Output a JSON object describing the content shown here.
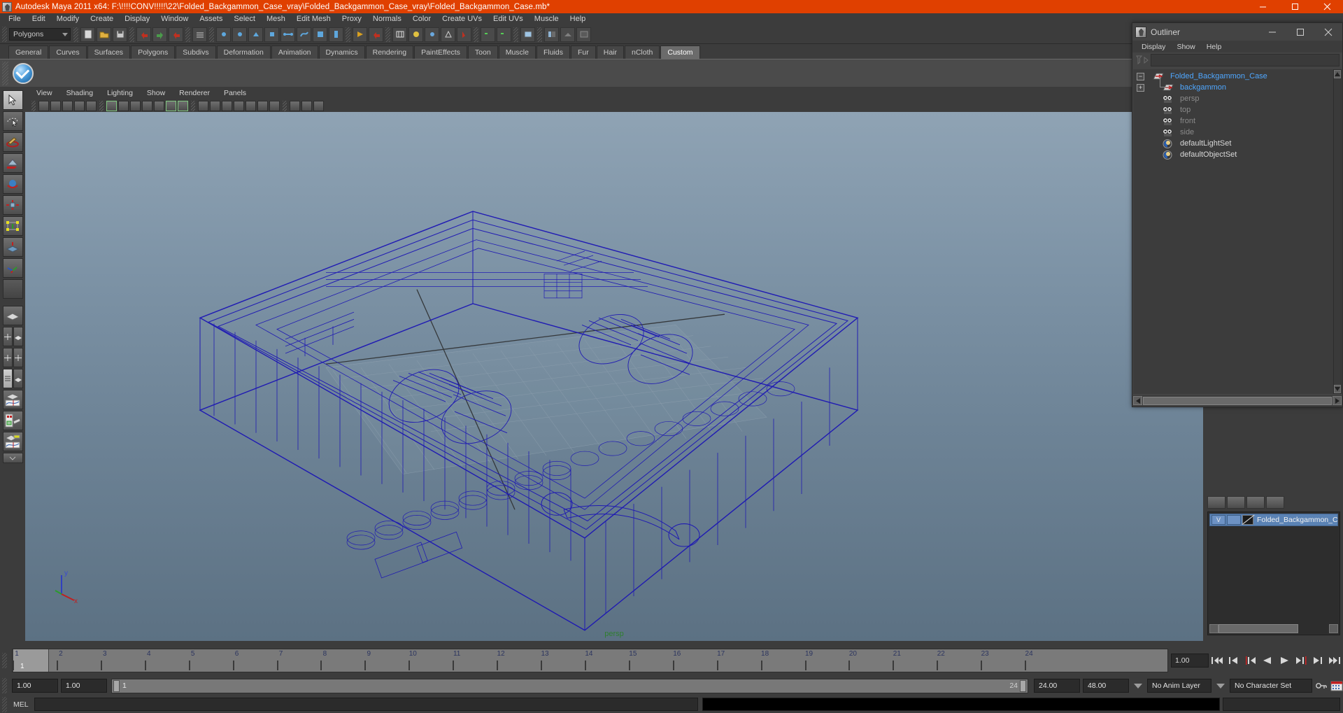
{
  "titlebar": {
    "app_title": "Autodesk Maya 2011 x64: F:\\!!!!CONV!!!!!\\22\\Folded_Backgammon_Case_vray\\Folded_Backgammon_Case_vray\\Folded_Backgammon_Case.mb*",
    "accent_color": "#e04000",
    "minimize": "minimize-icon",
    "maximize": "maximize-icon",
    "close": "close-icon"
  },
  "menubar": {
    "items": [
      "File",
      "Edit",
      "Modify",
      "Create",
      "Display",
      "Window",
      "Assets",
      "Select",
      "Mesh",
      "Edit Mesh",
      "Proxy",
      "Normals",
      "Color",
      "Create UVs",
      "Edit UVs",
      "Muscle",
      "Help"
    ]
  },
  "statusline": {
    "mode_selector": "Polygons"
  },
  "shelf": {
    "tabs": [
      "General",
      "Curves",
      "Surfaces",
      "Polygons",
      "Subdivs",
      "Deformation",
      "Animation",
      "Dynamics",
      "Rendering",
      "PaintEffects",
      "Toon",
      "Muscle",
      "Fluids",
      "Fur",
      "Hair",
      "nCloth",
      "Custom"
    ],
    "active_tab": "Custom"
  },
  "viewport": {
    "menus": [
      "View",
      "Shading",
      "Lighting",
      "Show",
      "Renderer",
      "Panels"
    ],
    "camera_label": "persp",
    "camera_label_color": "#2f7f2f",
    "wireframe_color": "#1c16b4",
    "axis_y_label": "y",
    "axis_x_label": "x",
    "axis_z_label": "z"
  },
  "outliner": {
    "window_title": "Outliner",
    "menus": [
      "Display",
      "Show",
      "Help"
    ],
    "search_value": "",
    "items": [
      {
        "label": "Folded_Backgammon_Case",
        "icon": "transform-icon",
        "expander": "minus",
        "indent": 0,
        "style": "blue"
      },
      {
        "label": "backgammon",
        "icon": "transform-icon",
        "expander": "plus",
        "indent": 1,
        "style": "blue"
      },
      {
        "label": "persp",
        "icon": "camera-icon",
        "expander": "none",
        "indent": 1,
        "style": "dim"
      },
      {
        "label": "top",
        "icon": "camera-icon",
        "expander": "none",
        "indent": 1,
        "style": "dim"
      },
      {
        "label": "front",
        "icon": "camera-icon",
        "expander": "none",
        "indent": 1,
        "style": "dim"
      },
      {
        "label": "side",
        "icon": "camera-icon",
        "expander": "none",
        "indent": 1,
        "style": "dim"
      },
      {
        "label": "defaultLightSet",
        "icon": "set-icon",
        "expander": "none",
        "indent": 1,
        "style": "white"
      },
      {
        "label": "defaultObjectSet",
        "icon": "set-icon",
        "expander": "none",
        "indent": 1,
        "style": "white"
      }
    ]
  },
  "layer_editor": {
    "layers": [
      {
        "visibility": "V",
        "playback": "",
        "name": "Folded_Backgammon_Cas"
      }
    ]
  },
  "timeslider": {
    "ticks": [
      1,
      2,
      3,
      4,
      5,
      6,
      7,
      8,
      9,
      10,
      11,
      12,
      13,
      14,
      15,
      16,
      17,
      18,
      19,
      20,
      21,
      22,
      23,
      24
    ],
    "current_frame": "1",
    "current_time_field": "1.00",
    "playback_buttons": [
      "go-to-start-icon",
      "step-back-keyframe-icon",
      "step-back-frame-icon",
      "play-backwards-icon",
      "play-forwards-icon",
      "step-forward-frame-icon",
      "step-forward-keyframe-icon",
      "go-to-end-icon"
    ]
  },
  "rangeslider": {
    "anim_start": "1.00",
    "range_start": "1.00",
    "bar_start_label": "1",
    "bar_end_label": "24",
    "range_end": "24.00",
    "anim_end": "48.00",
    "anim_layer": "No Anim Layer",
    "character_set": "No Character Set"
  },
  "commandline": {
    "label": "MEL",
    "input_value": "",
    "output_value": ""
  }
}
